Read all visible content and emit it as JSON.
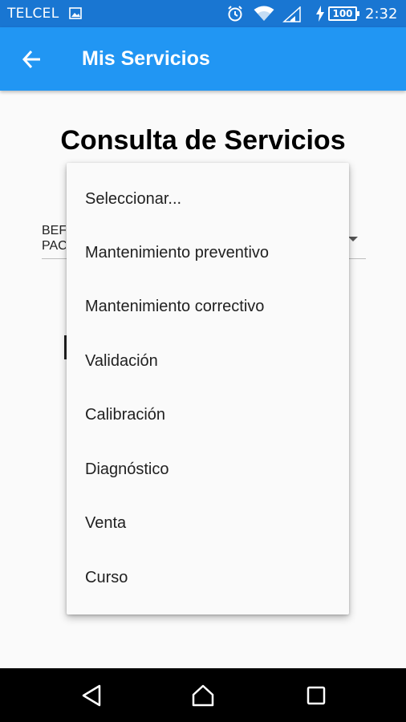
{
  "status_bar": {
    "carrier": "TELCEL",
    "battery_level": "100",
    "time": "2:32",
    "icons": [
      "picture-icon",
      "alarm-icon",
      "wifi-icon",
      "signal-icon",
      "charging-icon",
      "battery-icon"
    ]
  },
  "app_bar": {
    "title": "Mis Servicios",
    "back_icon": "arrow-left-icon",
    "color": "#2196f3"
  },
  "page": {
    "heading": "Consulta de Servicios",
    "select_partial_text": "BEF\nPAC"
  },
  "dropdown": {
    "options": [
      "Seleccionar...",
      "Mantenimiento preventivo",
      "Mantenimiento correctivo",
      "Validación",
      "Calibración",
      "Diagnóstico",
      "Venta",
      "Curso"
    ]
  },
  "nav_bar": {
    "icons": [
      "back-triangle-icon",
      "home-icon",
      "recents-square-icon"
    ]
  }
}
